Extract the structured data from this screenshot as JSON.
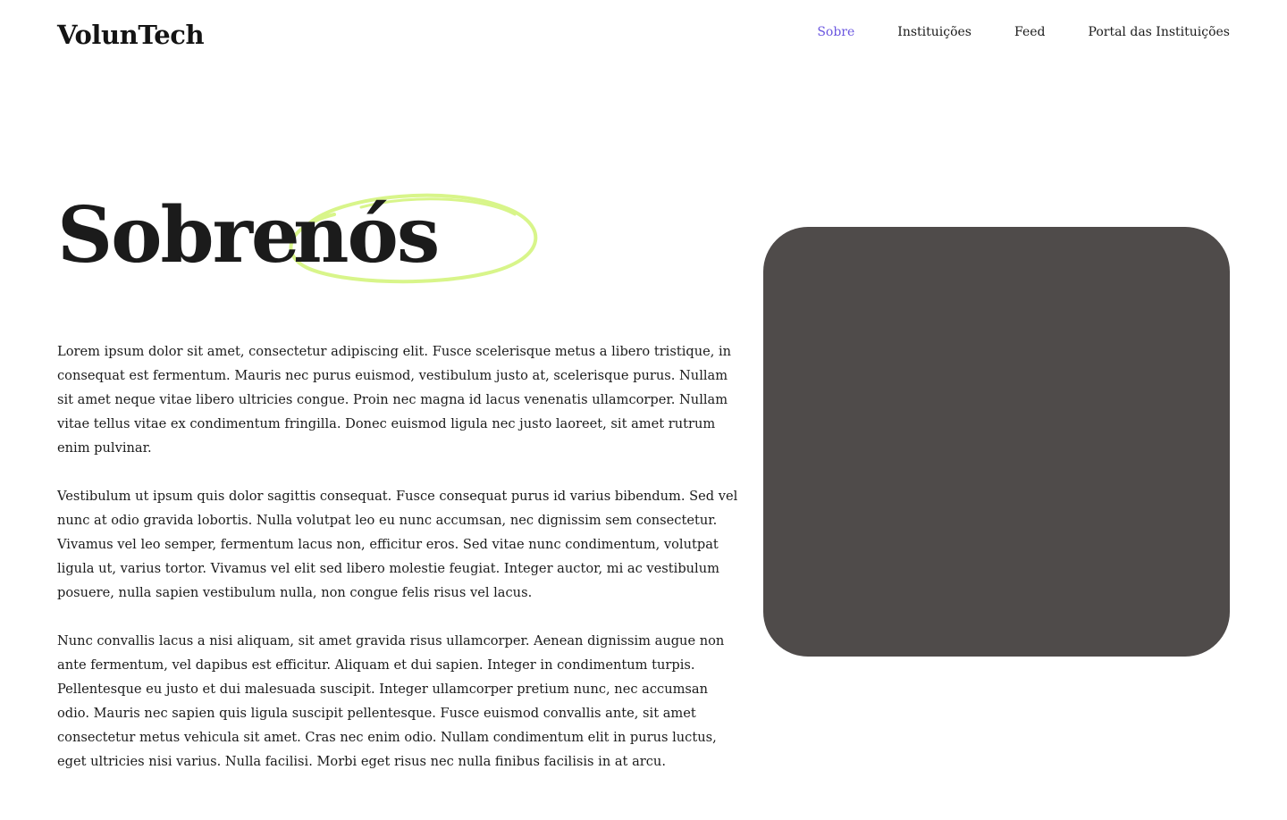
{
  "brand": {
    "name": "VolunTech"
  },
  "nav": {
    "items": [
      {
        "label": "Sobre",
        "active": true
      },
      {
        "label": "Instituições",
        "active": false
      },
      {
        "label": "Feed",
        "active": false
      },
      {
        "label": "Portal das Instituições",
        "active": false
      }
    ]
  },
  "hero": {
    "title_word_1": "Sobre",
    "title_word_2": "nós",
    "highlight_color": "#d8f58a"
  },
  "about": {
    "paragraphs": [
      "Lorem ipsum dolor sit amet, consectetur adipiscing elit. Fusce scelerisque metus a libero tristique, in consequat est fermentum. Mauris nec purus euismod, vestibulum justo at, scelerisque purus. Nullam sit amet neque vitae libero ultricies congue. Proin nec magna id lacus venenatis ullamcorper. Nullam vitae tellus vitae ex condimentum fringilla. Donec euismod ligula nec justo laoreet, sit amet rutrum enim pulvinar.",
      "Vestibulum ut ipsum quis dolor sagittis consequat. Fusce consequat purus id varius bibendum. Sed vel nunc at odio gravida lobortis. Nulla volutpat leo eu nunc accumsan, nec dignissim sem consectetur. Vivamus vel leo semper, fermentum lacus non, efficitur eros. Sed vitae nunc condimentum, volutpat ligula ut, varius tortor. Vivamus vel elit sed libero molestie feugiat. Integer auctor, mi ac vestibulum posuere, nulla sapien vestibulum nulla, non congue felis risus vel lacus.",
      "Nunc convallis lacus a nisi aliquam, sit amet gravida risus ullamcorper. Aenean dignissim augue non ante fermentum, vel dapibus est efficitur. Aliquam et dui sapien. Integer in condimentum turpis. Pellentesque eu justo et dui malesuada suscipit. Integer ullamcorper pretium nunc, nec accumsan odio. Mauris nec sapien quis ligula suscipit pellentesque. Fusce euismod convallis ante, sit amet consectetur metus vehicula sit amet. Cras nec enim odio. Nullam condimentum elit in purus luctus, eget ultricies nisi varius. Nulla facilisi. Morbi eget risus nec nulla finibus facilisis in at arcu."
    ]
  },
  "colors": {
    "accent": "#6b57e0",
    "image_placeholder": "#4f4b4a",
    "text": "#1b1b1b"
  }
}
